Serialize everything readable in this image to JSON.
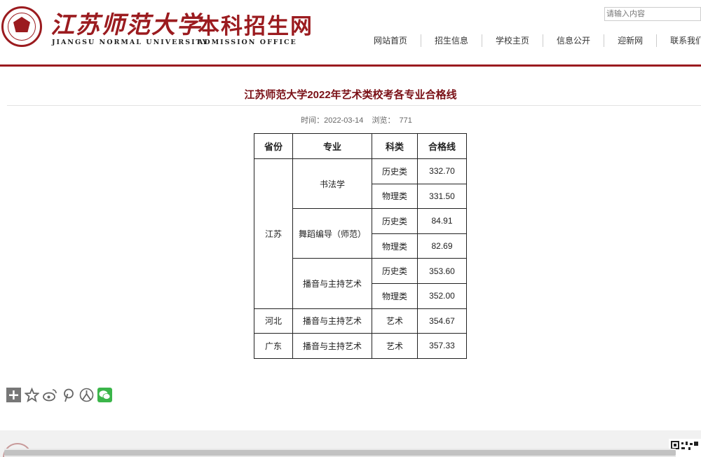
{
  "header": {
    "brand_cn": "江苏师范大学",
    "office_cn": "本科招生网",
    "brand_en": "JIANGSU NORMAL UNIVERSITY",
    "office_en": "ADMISSION OFFICE",
    "brand_color": "#9b1b1f",
    "search_placeholder": "请输入内容"
  },
  "nav": {
    "items": [
      "网站首页",
      "招生信息",
      "学校主页",
      "信息公开",
      "迎新网",
      "联系我们"
    ]
  },
  "article": {
    "title": "江苏师范大学2022年艺术类校考各专业合格线",
    "time_label": "时间：2022-03-14",
    "views_label": "浏览：",
    "views": "771"
  },
  "table": {
    "headers": [
      "省份",
      "专业",
      "科类",
      "合格线"
    ],
    "rows": [
      {
        "province": "江苏",
        "major": "书法学",
        "category": "历史类",
        "score": "332.70"
      },
      {
        "province": "江苏",
        "major": "书法学",
        "category": "物理类",
        "score": "331.50"
      },
      {
        "province": "江苏",
        "major": "舞蹈编导（师范）",
        "category": "历史类",
        "score": "84.91"
      },
      {
        "province": "江苏",
        "major": "舞蹈编导（师范）",
        "category": "物理类",
        "score": "82.69"
      },
      {
        "province": "江苏",
        "major": "播音与主持艺术",
        "category": "历史类",
        "score": "353.60"
      },
      {
        "province": "江苏",
        "major": "播音与主持艺术",
        "category": "物理类",
        "score": "352.00"
      },
      {
        "province": "河北",
        "major": "播音与主持艺术",
        "category": "艺术",
        "score": "354.67"
      },
      {
        "province": "广东",
        "major": "播音与主持艺术",
        "category": "艺术",
        "score": "357.33"
      }
    ]
  },
  "share": {
    "icons": [
      "plus-icon",
      "star-icon",
      "weibo-icon",
      "pinterest-icon",
      "renren-icon",
      "wechat-icon"
    ],
    "wechat_color": "#3bb54a"
  }
}
